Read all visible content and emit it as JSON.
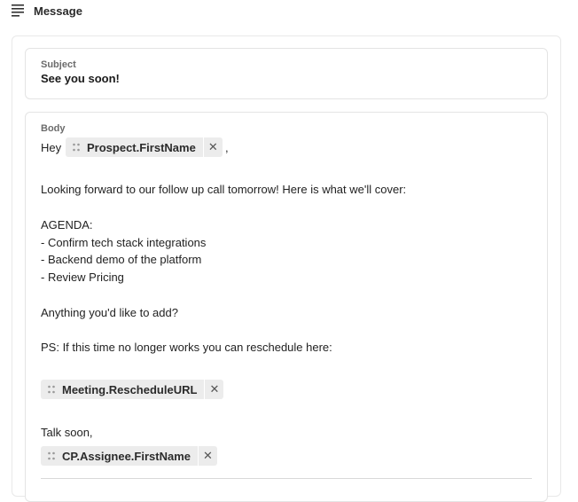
{
  "header": {
    "title": "Message",
    "icon": "text-align-left-icon"
  },
  "subject": {
    "label": "Subject",
    "value": "See you soon!"
  },
  "body": {
    "label": "Body",
    "greeting_prefix": "Hey",
    "greeting_suffix": ",",
    "tokens": {
      "prospect_first_name": "Prospect.FirstName",
      "meeting_reschedule_url": "Meeting.RescheduleURL",
      "assignee_first_name": "CP.Assignee.FirstName"
    },
    "lines": {
      "intro": "Looking forward to our follow up call tomorrow! Here is what we'll cover:",
      "agenda_title": "AGENDA:",
      "agenda_1": "- Confirm tech stack integrations",
      "agenda_2": "- Backend demo of the platform",
      "agenda_3": "- Review Pricing",
      "question": "Anything you'd like to add?",
      "ps": "PS: If this time no longer works you can reschedule here:",
      "signoff": "Talk soon,"
    }
  }
}
